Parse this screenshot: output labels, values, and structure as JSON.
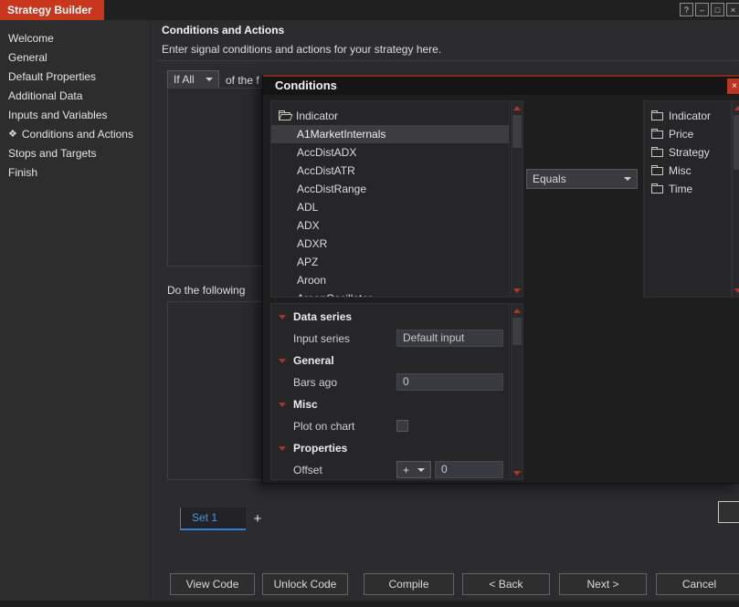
{
  "window": {
    "title": "Strategy Builder",
    "controls": {
      "help": "?",
      "minimize": "–",
      "maximize": "□",
      "close": "×"
    }
  },
  "sidebar": {
    "selected_icon": "❖",
    "items": [
      "Welcome",
      "General",
      "Default Properties",
      "Additional Data",
      "Inputs and Variables",
      "Conditions and Actions",
      "Stops and Targets",
      "Finish"
    ]
  },
  "main": {
    "heading": "Conditions and Actions",
    "subheading": "Enter signal conditions and actions for your strategy here.",
    "condition_scope_dropdown": "If All",
    "condition_scope_suffix": "of the f",
    "do_following_label": "Do the following",
    "set_tab_label": "Set 1",
    "add_set_label": "+"
  },
  "dialog": {
    "title": "Conditions",
    "close_label": "×",
    "left_tree": {
      "root": "Indicator",
      "selected": "A1MarketInternals",
      "items": [
        "A1MarketInternals",
        "AccDistADX",
        "AccDistATR",
        "AccDistRange",
        "ADL",
        "ADX",
        "ADXR",
        "APZ",
        "Aroon",
        "AroonOscillator"
      ]
    },
    "operator_dropdown": "Equals",
    "right_tree": {
      "folders": [
        "Indicator",
        "Price",
        "Strategy",
        "Misc",
        "Time"
      ]
    },
    "properties": {
      "category_data_series": "Data series",
      "input_series_label": "Input series",
      "input_series_value": "Default input",
      "category_general": "General",
      "bars_ago_label": "Bars ago",
      "bars_ago_value": "0",
      "category_misc": "Misc",
      "plot_on_chart_label": "Plot on chart",
      "plot_on_chart_checked": false,
      "category_properties": "Properties",
      "offset_label": "Offset",
      "offset_sign": "+",
      "offset_value": "0"
    }
  },
  "footer": {
    "buttons": [
      "View Code",
      "Unlock Code",
      "Compile",
      "< Back",
      "Next >",
      "Cancel"
    ]
  },
  "colors": {
    "accent_red": "#c8371d",
    "expander_red": "#a5352b",
    "scroll_arrow_red": "#b5342a",
    "tab_blue": "#3f9bdc",
    "dialog_title_border": "#7e2c1f"
  }
}
